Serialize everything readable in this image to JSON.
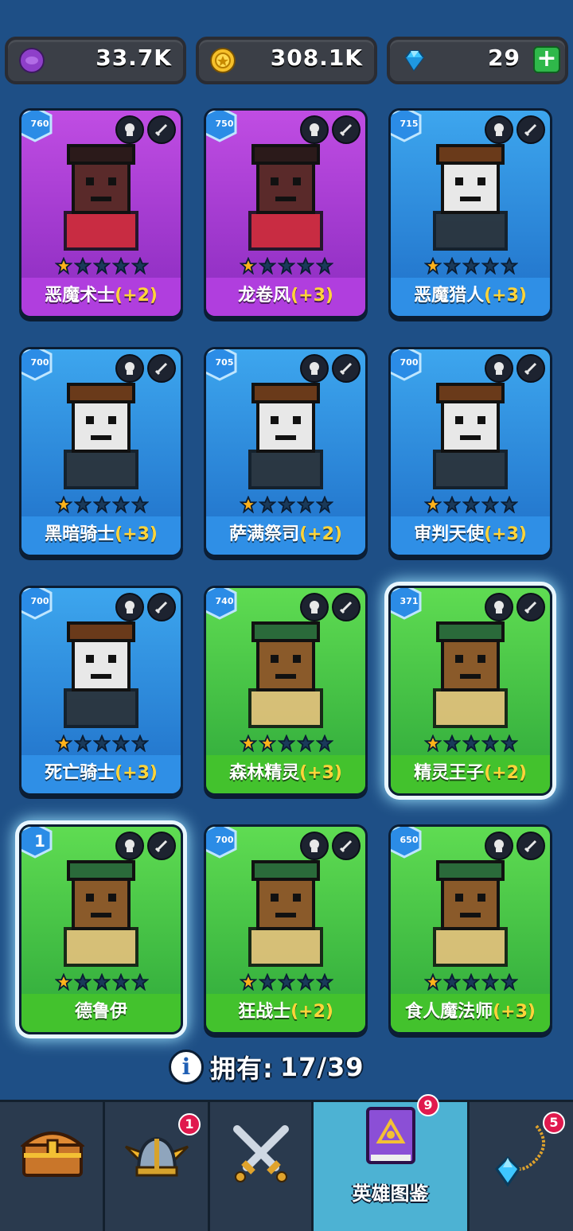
{
  "currencies": [
    {
      "id": "purple-coin",
      "value": "33.7K",
      "color": "#8e3fc9"
    },
    {
      "id": "gold-coin",
      "value": "308.1K",
      "color": "#f6c02a"
    },
    {
      "id": "gem",
      "value": "29",
      "color": "#3ec6ff"
    }
  ],
  "heroes": [
    {
      "name": "恶魔术士",
      "bonus": "(+2)",
      "level": "760",
      "stars": 1,
      "rarity": "purple"
    },
    {
      "name": "龙卷风",
      "bonus": "(+3)",
      "level": "750",
      "stars": 1,
      "rarity": "purple"
    },
    {
      "name": "恶魔猎人",
      "bonus": "(+3)",
      "level": "715",
      "stars": 1,
      "rarity": "blue"
    },
    {
      "name": "黑暗骑士",
      "bonus": "(+3)",
      "level": "700",
      "stars": 1,
      "rarity": "blue"
    },
    {
      "name": "萨满祭司",
      "bonus": "(+2)",
      "level": "705",
      "stars": 1,
      "rarity": "blue"
    },
    {
      "name": "审判天使",
      "bonus": "(+3)",
      "level": "700",
      "stars": 1,
      "rarity": "blue"
    },
    {
      "name": "死亡骑士",
      "bonus": "(+3)",
      "level": "700",
      "stars": 1,
      "rarity": "blue"
    },
    {
      "name": "森林精灵",
      "bonus": "(+3)",
      "level": "740",
      "stars": 2,
      "rarity": "green"
    },
    {
      "name": "精灵王子",
      "bonus": "(+2)",
      "level": "371",
      "stars": 1,
      "rarity": "green"
    },
    {
      "name": "德鲁伊",
      "bonus": "",
      "level": "1",
      "stars": 1,
      "rarity": "green"
    },
    {
      "name": "狂战士",
      "bonus": "(+2)",
      "level": "700",
      "stars": 1,
      "rarity": "green"
    },
    {
      "name": "食人魔法师",
      "bonus": "(+3)",
      "level": "650",
      "stars": 1,
      "rarity": "green"
    }
  ],
  "owned": {
    "label": "拥有:",
    "count": "17/39"
  },
  "nav": {
    "chest": {
      "icon": "treasure-chest-icon"
    },
    "helmet": {
      "icon": "viking-helmet-icon",
      "badge": "1"
    },
    "battle": {
      "icon": "crossed-swords-icon"
    },
    "heroes": {
      "icon": "hero-book-icon",
      "badge": "9",
      "label": "英雄图鉴"
    },
    "amulet": {
      "icon": "amulet-icon",
      "badge": "5"
    }
  }
}
